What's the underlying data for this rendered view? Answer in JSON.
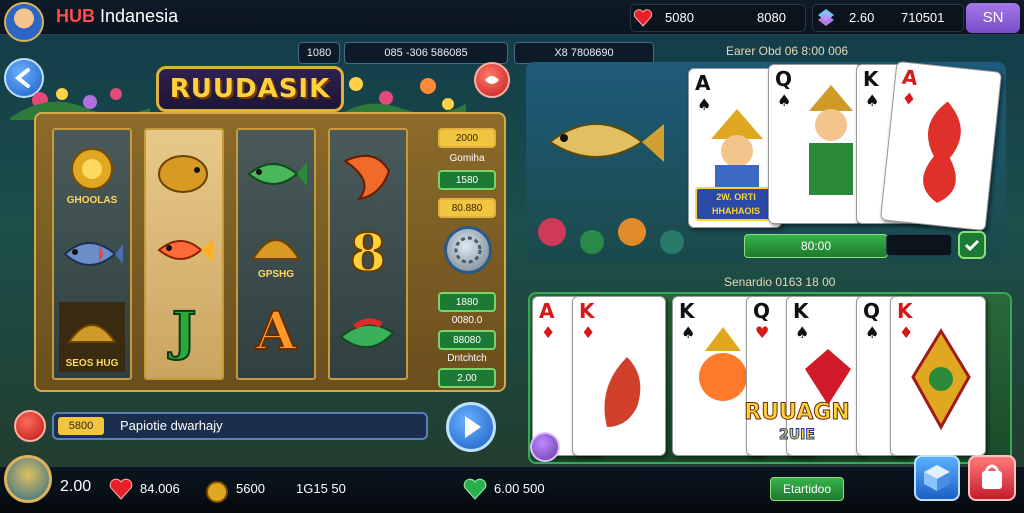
{
  "header": {
    "brand_hub": "HUB",
    "brand_rest": "Indanesia",
    "pill1_a": "5080",
    "pill1_b": "8080",
    "pill2_a": "2.60",
    "pill2_b": "710501",
    "sn_label": "SN"
  },
  "info": {
    "pill_small": "1080",
    "pill_mid": "085 -306 586085",
    "pill_right": "X8 7808690",
    "right_label": "Earer Obd 06 8:00 006"
  },
  "slot": {
    "title": "RUUDASIK",
    "top_sym_text": "GHOOLAS",
    "bottom_sym_text": "SEOS HUG",
    "mid_sym_text": "GPSHG",
    "letters": [
      "J",
      "A",
      "8"
    ],
    "side_labels": [
      "2000",
      "Gomiha",
      "1580",
      "80.880",
      "1880",
      "0080.0",
      "88080",
      "Dntchtch",
      "2.00"
    ],
    "input_tag": "5800",
    "input_text": "Papiotie dwarhajy"
  },
  "right_top": {
    "green_bar": "80:00",
    "card_logo": "2W. ORTI HHAHAOIS",
    "cards": [
      {
        "rank": "A",
        "suit": "♠",
        "color": "blk"
      },
      {
        "rank": "Q",
        "suit": "♠",
        "color": "blk"
      },
      {
        "rank": "K",
        "suit": "♠",
        "color": "blk"
      },
      {
        "rank": "A",
        "suit": "♦",
        "color": "red"
      }
    ]
  },
  "right_bottom": {
    "label": "Senardio 0163 18 00",
    "logo_line1": "RUUAGN",
    "logo_line2": "2UIE",
    "cards": [
      {
        "rank": "A",
        "suit": "♦",
        "color": "red"
      },
      {
        "rank": "K",
        "suit": "♦",
        "color": "red"
      },
      {
        "rank": "K",
        "suit": "♠",
        "color": "blk"
      },
      {
        "rank": "Q",
        "suit": "♥",
        "color": "red"
      },
      {
        "rank": "K",
        "suit": "♠",
        "color": "blk"
      },
      {
        "rank": "Q",
        "suit": "♠",
        "color": "blk"
      },
      {
        "rank": "K",
        "suit": "♦",
        "color": "red"
      }
    ]
  },
  "bottom": {
    "balance": "2.00",
    "hearts": "84.006",
    "coins": "5600",
    "coins2": "1G15 50",
    "gems": "6.00 500",
    "btn_label": "Etartidoo"
  },
  "colors": {
    "accent_gold": "#e0b040",
    "accent_green": "#36b34a",
    "accent_purple": "#a478e8",
    "brand_red": "#ff4b4b"
  }
}
